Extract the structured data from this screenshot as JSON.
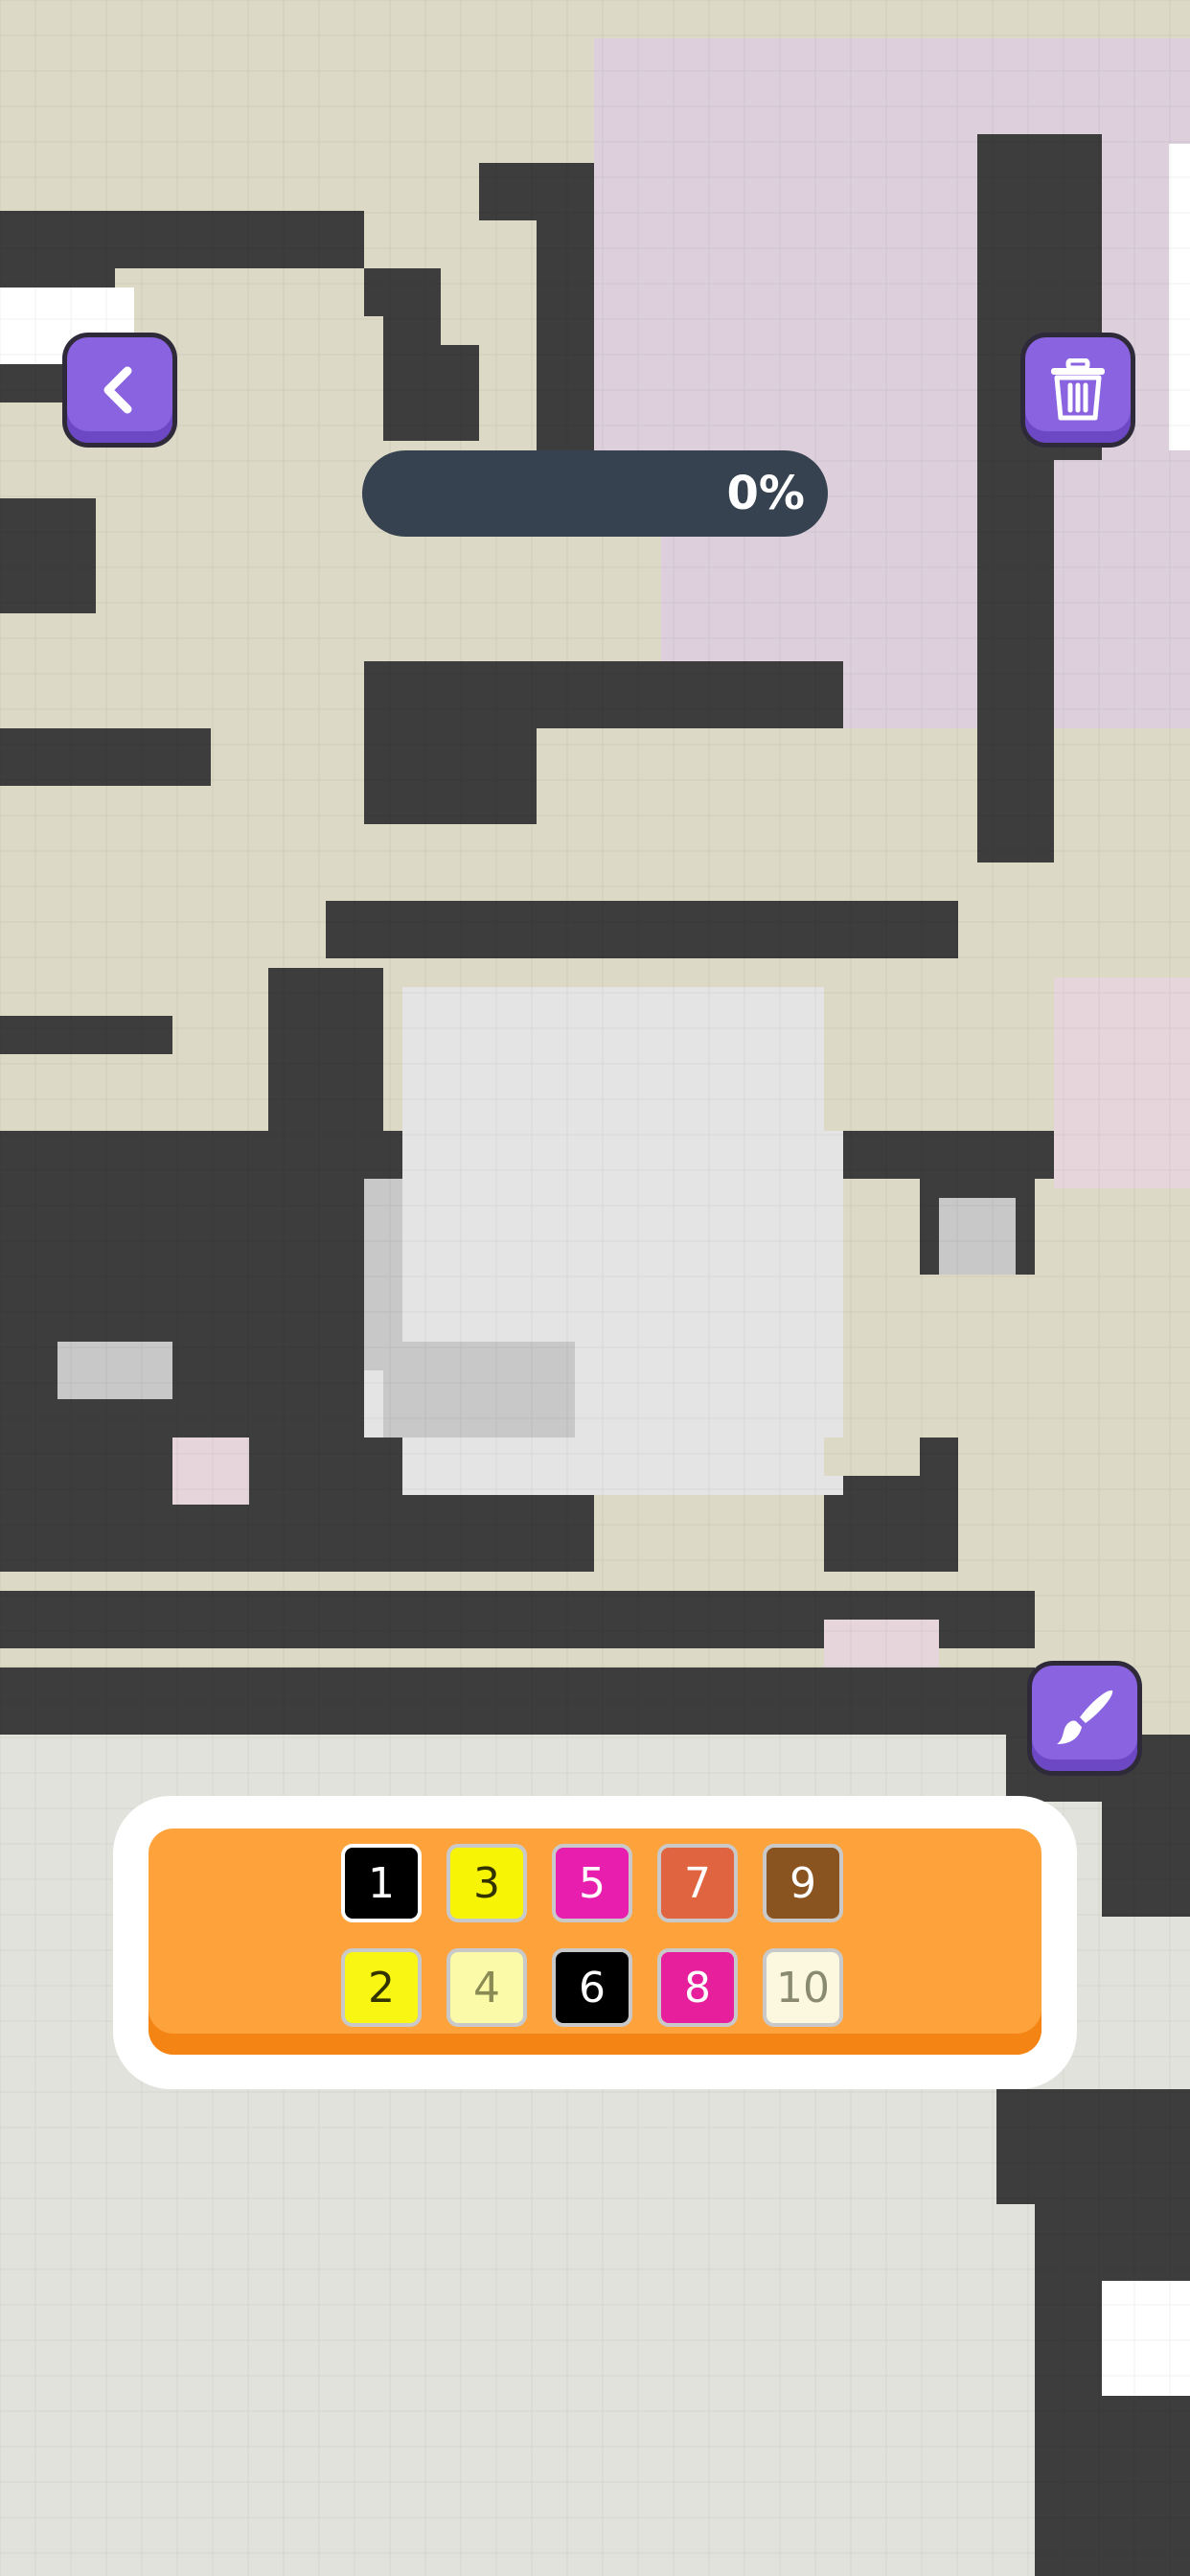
{
  "progress": {
    "percent_label": "0%",
    "value": 0
  },
  "controls": {
    "back_icon": "chevron-left-icon",
    "trash_icon": "trash-icon",
    "brush_icon": "paintbrush-icon"
  },
  "palette": {
    "swatches": [
      {
        "label": "1",
        "color": "#000000",
        "text_color": "#ffffff",
        "selected": true
      },
      {
        "label": "3",
        "color": "#f7f406",
        "text_color": "#333300"
      },
      {
        "label": "5",
        "color": "#e81fae",
        "text_color": "#ffffff"
      },
      {
        "label": "7",
        "color": "#e06440",
        "text_color": "#ffffff"
      },
      {
        "label": "9",
        "color": "#8a5420",
        "text_color": "#ffffff"
      },
      {
        "label": "2",
        "color": "#f8f612",
        "text_color": "#333300"
      },
      {
        "label": "4",
        "color": "#fafaa8",
        "text_color": "#8a8a55"
      },
      {
        "label": "6",
        "color": "#000000",
        "text_color": "#ffffff"
      },
      {
        "label": "8",
        "color": "#e81f9c",
        "text_color": "#ffffff"
      },
      {
        "label": "10",
        "color": "#fcf8e0",
        "text_color": "#8a8a70"
      }
    ]
  },
  "colors": {
    "dark_cell": "#3d3d3d",
    "cream_cell": "#dcdac6",
    "pink_cell": "#ddd0dc",
    "light_cell": "#e0e0e0",
    "grey_cell": "#c8c8c8",
    "accent_purple": "#8a63e0"
  }
}
